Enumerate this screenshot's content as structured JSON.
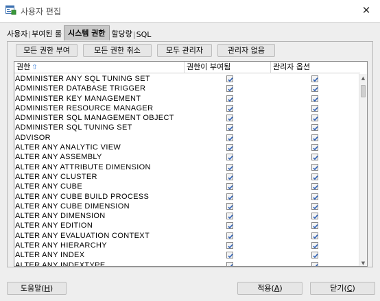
{
  "window": {
    "title": "사용자 편집",
    "icon": "user-edit-icon",
    "close_glyph": "✕"
  },
  "tabs": [
    {
      "label": "사용자",
      "active": false
    },
    {
      "label": "부여된 롤",
      "active": false
    },
    {
      "label": "시스템 권한",
      "active": true
    },
    {
      "label": "할당량",
      "active": false
    },
    {
      "label": "SQL",
      "active": false
    }
  ],
  "toolbar": {
    "grant_all": "모든 권한 부여",
    "revoke_all": "모든 권한 취소",
    "all_admin": "모두 관리자",
    "no_admin": "관리자 없음"
  },
  "table": {
    "headers": {
      "privilege": "권한",
      "granted": "권한이 부여됨",
      "admin_option": "관리자 옵션"
    },
    "sort_indicator": "⇧",
    "rows": [
      {
        "privilege": "ADMINISTER ANY SQL TUNING SET",
        "granted": true,
        "admin": true
      },
      {
        "privilege": "ADMINISTER DATABASE TRIGGER",
        "granted": true,
        "admin": true
      },
      {
        "privilege": "ADMINISTER KEY MANAGEMENT",
        "granted": true,
        "admin": true
      },
      {
        "privilege": "ADMINISTER RESOURCE MANAGER",
        "granted": true,
        "admin": true
      },
      {
        "privilege": "ADMINISTER SQL MANAGEMENT OBJECT",
        "granted": true,
        "admin": true
      },
      {
        "privilege": "ADMINISTER SQL TUNING SET",
        "granted": true,
        "admin": true
      },
      {
        "privilege": "ADVISOR",
        "granted": true,
        "admin": true
      },
      {
        "privilege": "ALTER ANY ANALYTIC VIEW",
        "granted": true,
        "admin": true
      },
      {
        "privilege": "ALTER ANY ASSEMBLY",
        "granted": true,
        "admin": true
      },
      {
        "privilege": "ALTER ANY ATTRIBUTE DIMENSION",
        "granted": true,
        "admin": true
      },
      {
        "privilege": "ALTER ANY CLUSTER",
        "granted": true,
        "admin": true
      },
      {
        "privilege": "ALTER ANY CUBE",
        "granted": true,
        "admin": true
      },
      {
        "privilege": "ALTER ANY CUBE BUILD PROCESS",
        "granted": true,
        "admin": true
      },
      {
        "privilege": "ALTER ANY CUBE DIMENSION",
        "granted": true,
        "admin": true
      },
      {
        "privilege": "ALTER ANY DIMENSION",
        "granted": true,
        "admin": true
      },
      {
        "privilege": "ALTER ANY EDITION",
        "granted": true,
        "admin": true
      },
      {
        "privilege": "ALTER ANY EVALUATION CONTEXT",
        "granted": true,
        "admin": true
      },
      {
        "privilege": "ALTER ANY HIERARCHY",
        "granted": true,
        "admin": true
      },
      {
        "privilege": "ALTER ANY INDEX",
        "granted": true,
        "admin": true
      },
      {
        "privilege": "ALTER ANY INDEXTYPE",
        "granted": true,
        "admin": true
      }
    ]
  },
  "footer": {
    "help": {
      "label": "도움말(",
      "key": "H",
      "end": ")"
    },
    "apply": {
      "label": "적용(",
      "key": "A",
      "end": ")"
    },
    "close": {
      "label": "닫기(",
      "key": "C",
      "end": ")"
    }
  }
}
